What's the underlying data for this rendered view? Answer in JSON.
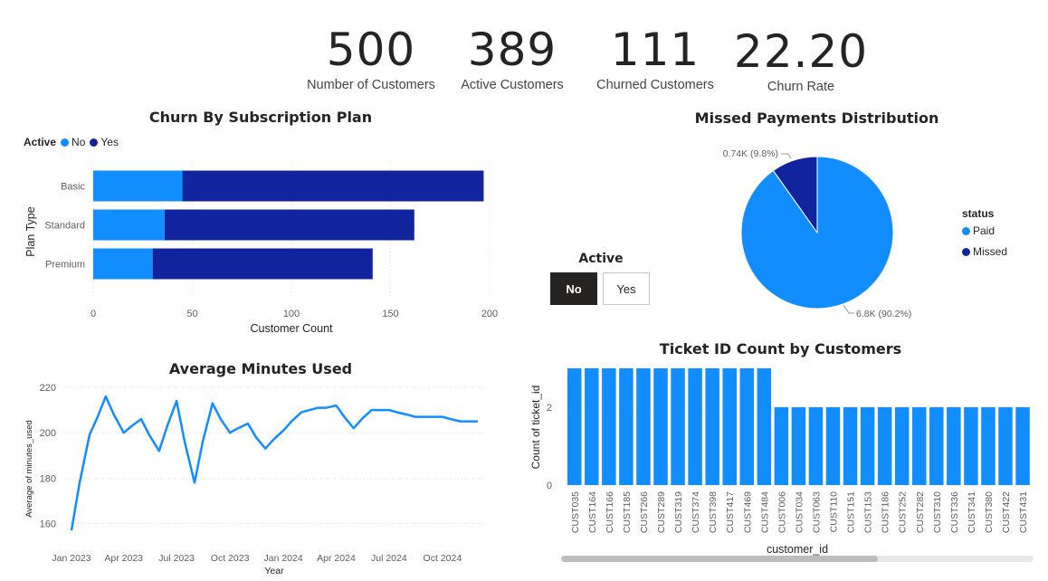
{
  "kpis": [
    {
      "value": "500",
      "label": "Number of Customers"
    },
    {
      "value": "389",
      "label": "Active Customers"
    },
    {
      "value": "111",
      "label": "Churned Customers"
    },
    {
      "value": "22.20",
      "label": "Churn Rate"
    }
  ],
  "colors": {
    "light_blue": "#118DFF",
    "dark_blue": "#12239E",
    "text": "#252423",
    "grid": "#e1dfdd"
  },
  "slicer": {
    "title": "Active",
    "options": [
      "No",
      "Yes"
    ],
    "selected": "No"
  },
  "chart_data": [
    {
      "type": "bar",
      "orientation": "horizontal",
      "stacked": true,
      "title": "Churn By Subscription Plan",
      "legend_title": "Active",
      "legend_placement": "top-left",
      "categories": [
        "Basic",
        "Standard",
        "Premium"
      ],
      "series": [
        {
          "name": "No",
          "values": [
            45,
            36,
            30
          ],
          "color": "#118DFF"
        },
        {
          "name": "Yes",
          "values": [
            152,
            126,
            111
          ],
          "color": "#12239E"
        }
      ],
      "xlabel": "Customer Count",
      "ylabel": "Plan Type",
      "xlim": [
        0,
        200
      ],
      "xticks": [
        "0",
        "50",
        "100",
        "150",
        "200"
      ],
      "grid": true
    },
    {
      "type": "pie",
      "title": "Missed Payments Distribution",
      "legend_title": "status",
      "legend_placement": "right",
      "slices": [
        {
          "name": "Paid",
          "value": 6.8,
          "label": "6.8K (90.2%)",
          "color": "#118DFF"
        },
        {
          "name": "Missed",
          "value": 0.74,
          "label": "0.74K (9.8%)",
          "color": "#12239E"
        }
      ]
    },
    {
      "type": "line",
      "title": "Average Minutes Used",
      "xlabel": "Year",
      "ylabel": "Average of minutes_used",
      "ylim": [
        155,
        222
      ],
      "yticks": [
        160,
        180,
        200,
        220
      ],
      "xticks": [
        "Jan 2023",
        "Apr 2023",
        "Jul 2023",
        "Oct 2023",
        "Jan 2024",
        "Apr 2024",
        "Jul 2024",
        "Oct 2024"
      ],
      "x": [
        "2023-01-01",
        "2023-01-15",
        "2023-02-01",
        "2023-02-15",
        "2023-03-01",
        "2023-03-15",
        "2023-04-01",
        "2023-04-15",
        "2023-05-01",
        "2023-05-15",
        "2023-06-01",
        "2023-06-15",
        "2023-07-01",
        "2023-07-15",
        "2023-08-01",
        "2023-08-15",
        "2023-09-01",
        "2023-09-15",
        "2023-10-01",
        "2023-10-15",
        "2023-11-01",
        "2023-11-15",
        "2023-12-01",
        "2023-12-15",
        "2024-01-01",
        "2024-01-15",
        "2024-02-01",
        "2024-02-15",
        "2024-03-01",
        "2024-03-15",
        "2024-04-01",
        "2024-04-15",
        "2024-05-01",
        "2024-05-15",
        "2024-06-01",
        "2024-06-15",
        "2024-07-01",
        "2024-07-15",
        "2024-08-01",
        "2024-08-15",
        "2024-09-01",
        "2024-09-15",
        "2024-10-01",
        "2024-10-15",
        "2024-11-01",
        "2024-11-15",
        "2024-12-01"
      ],
      "values": [
        157,
        178,
        199,
        207,
        216,
        208,
        200,
        203,
        206,
        199,
        192,
        203,
        214,
        196,
        178,
        196,
        213,
        206,
        200,
        202,
        204,
        198,
        193,
        197,
        201,
        205,
        209,
        210,
        211,
        211,
        212,
        207,
        202,
        206,
        210,
        210,
        210,
        209,
        208,
        207,
        207,
        207,
        207,
        206,
        205,
        205,
        205
      ],
      "color": "#118DFF",
      "grid": true
    },
    {
      "type": "bar",
      "title": "Ticket ID Count by Customers",
      "xlabel": "customer_id",
      "ylabel": "Count of ticket_id",
      "ylim": [
        0,
        3
      ],
      "yticks": [
        0,
        2
      ],
      "categories": [
        "CUST035",
        "CUST164",
        "CUST166",
        "CUST185",
        "CUST266",
        "CUST289",
        "CUST319",
        "CUST374",
        "CUST398",
        "CUST417",
        "CUST469",
        "CUST484",
        "CUST006",
        "CUST034",
        "CUST063",
        "CUST110",
        "CUST151",
        "CUST153",
        "CUST186",
        "CUST252",
        "CUST282",
        "CUST310",
        "CUST336",
        "CUST341",
        "CUST380",
        "CUST422",
        "CUST431"
      ],
      "values": [
        3,
        3,
        3,
        3,
        3,
        3,
        3,
        3,
        3,
        3,
        3,
        3,
        2,
        2,
        2,
        2,
        2,
        2,
        2,
        2,
        2,
        2,
        2,
        2,
        2,
        2,
        2
      ],
      "color": "#118DFF",
      "grid": true
    }
  ]
}
